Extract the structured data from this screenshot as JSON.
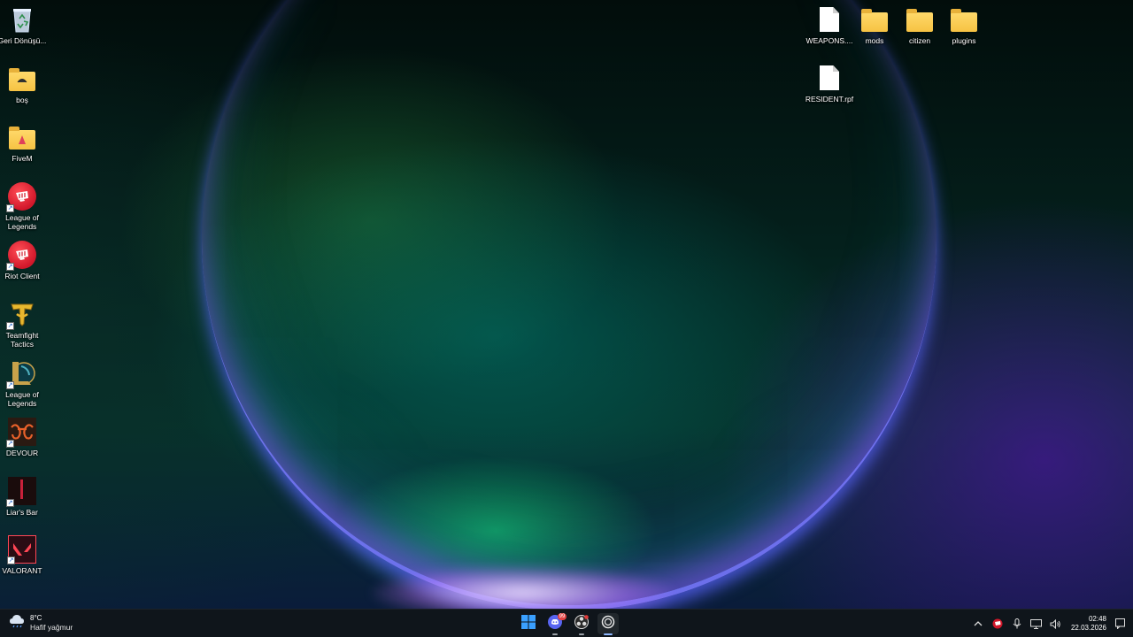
{
  "desktop": {
    "left_icons": [
      {
        "label": "Geri Dönüşü...",
        "icon": "recycle-bin-icon"
      },
      {
        "label": "boş",
        "icon": "folder-icon"
      },
      {
        "label": "FiveM",
        "icon": "folder-fivem-icon"
      },
      {
        "label": "League of Legends",
        "icon": "riot-league-icon"
      },
      {
        "label": "Riot Client",
        "icon": "riot-client-icon"
      },
      {
        "label": "Teamfight Tactics",
        "icon": "teamfight-tactics-icon"
      },
      {
        "label": "League of Legends",
        "icon": "league-of-legends-icon"
      },
      {
        "label": "DEVOUR",
        "icon": "devour-icon"
      },
      {
        "label": "Liar's Bar",
        "icon": "liars-bar-icon"
      },
      {
        "label": "VALORANT",
        "icon": "valorant-icon"
      }
    ],
    "right_icons": [
      {
        "label": "WEAPONS....",
        "icon": "file-icon"
      },
      {
        "label": "mods",
        "icon": "folder-icon"
      },
      {
        "label": "citizen",
        "icon": "folder-icon"
      },
      {
        "label": "plugins",
        "icon": "folder-icon"
      },
      {
        "label": "RESIDENT.rpf",
        "icon": "file-icon"
      }
    ]
  },
  "taskbar": {
    "weather": {
      "temp": "8°C",
      "condition": "Hafif yağmur",
      "icon": "cloud-rain-icon"
    },
    "apps": [
      {
        "name": "start",
        "icon": "windows-start-icon"
      },
      {
        "name": "discord",
        "icon": "discord-icon",
        "badge": "99"
      },
      {
        "name": "obs",
        "icon": "obs-icon"
      },
      {
        "name": "capture",
        "icon": "record-icon"
      }
    ],
    "tray": {
      "time": "02:48",
      "date": "22.03.2026"
    }
  },
  "colors": {
    "taskbar_bg": "#10161c",
    "folder": "#f6c343",
    "riot_red": "#d1172a",
    "accent": "#8fb8ff"
  }
}
